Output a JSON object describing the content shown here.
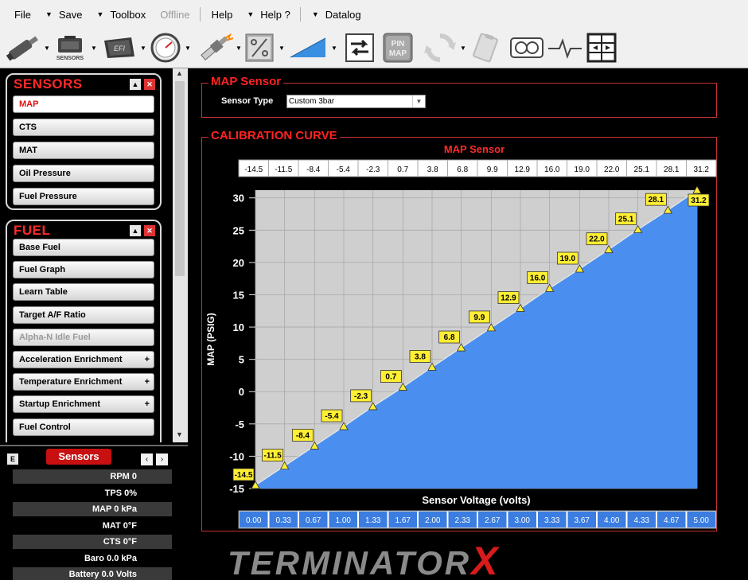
{
  "menu": {
    "items": [
      {
        "label": "File",
        "arrow": false
      },
      {
        "label": "Save",
        "arrow": true
      },
      {
        "label": "Toolbox",
        "arrow": true
      },
      {
        "label": "Offline",
        "arrow": false,
        "disabled": true
      },
      {
        "label": "Help",
        "arrow": false
      },
      {
        "label": "Help ?",
        "arrow": true
      },
      {
        "label": "Datalog",
        "arrow": true
      }
    ]
  },
  "toolbar": {
    "sensors_label": "SENSORS",
    "efi_label": "EFI",
    "pinmap_label_top": "PIN",
    "pinmap_label_bottom": "MAP",
    "icons": [
      "injector-icon",
      "sensors-module-icon",
      "efi-ecu-icon",
      "gauge-icon",
      "spark-plug-icon",
      "percent-icon",
      "ramp-icon",
      "transfer-icon",
      "pin-map-icon",
      "refresh-icon",
      "clipboard-icon",
      "dash-gauges-icon",
      "heartbeat-icon",
      "grid-window-icon"
    ]
  },
  "sensors_section": {
    "title": "SENSORS",
    "items": [
      {
        "label": "MAP",
        "active": true
      },
      {
        "label": "CTS"
      },
      {
        "label": "MAT"
      },
      {
        "label": "Oil Pressure"
      },
      {
        "label": "Fuel Pressure"
      }
    ]
  },
  "fuel_section": {
    "title": "FUEL",
    "items": [
      {
        "label": "Base Fuel",
        "suffix": ""
      },
      {
        "label": "Fuel Graph",
        "suffix": ""
      },
      {
        "label": "Learn Table",
        "suffix": ""
      },
      {
        "label": "Target A/F Ratio",
        "suffix": ""
      },
      {
        "label": "Alpha-N Idle Fuel",
        "suffix": "",
        "disabled": true
      },
      {
        "label": "Acceleration Enrichment",
        "suffix": "+"
      },
      {
        "label": "Temperature Enrichment",
        "suffix": "+"
      },
      {
        "label": "Startup Enrichment",
        "suffix": "+"
      },
      {
        "label": "Fuel Control",
        "suffix": ""
      }
    ]
  },
  "sensor_panel": {
    "e_label": "E",
    "title": "Sensors",
    "rows": [
      "RPM 0",
      "TPS 0%",
      "MAP 0 kPa",
      "MAT 0°F",
      "CTS 0°F",
      "Baro 0.0 kPa",
      "Battery 0.0 Volts"
    ]
  },
  "map_sensor": {
    "frame_title": "MAP Sensor",
    "sensor_type_label": "Sensor Type",
    "sensor_type_value": "Custom 3bar"
  },
  "calibration": {
    "frame_title": "CALIBRATION CURVE",
    "chart_title": "MAP Sensor"
  },
  "chart_data": {
    "type": "area",
    "title": "MAP Sensor",
    "xlabel": "Sensor Voltage (volts)",
    "ylabel": "MAP (PSIG)",
    "x": [
      0.0,
      0.33,
      0.67,
      1.0,
      1.33,
      1.67,
      2.0,
      2.33,
      2.67,
      3.0,
      3.33,
      3.67,
      4.0,
      4.33,
      4.67,
      5.0
    ],
    "x_labels": [
      "0.00",
      "0.33",
      "0.67",
      "1.00",
      "1.33",
      "1.67",
      "2.00",
      "2.33",
      "2.67",
      "3.00",
      "3.33",
      "3.67",
      "4.00",
      "4.33",
      "4.67",
      "5.00"
    ],
    "y": [
      -14.5,
      -11.5,
      -8.4,
      -5.4,
      -2.3,
      0.7,
      3.8,
      6.8,
      9.9,
      12.9,
      16.0,
      19.0,
      22.0,
      25.1,
      28.1,
      31.2
    ],
    "y_labels": [
      "-14.5",
      "-11.5",
      "-8.4",
      "-5.4",
      "-2.3",
      "0.7",
      "3.8",
      "6.8",
      "9.9",
      "12.9",
      "16.0",
      "19.0",
      "22.0",
      "25.1",
      "28.1",
      "31.2"
    ],
    "y_ticks": [
      "30",
      "25",
      "20",
      "15",
      "10",
      "5",
      "0",
      "-5",
      "-10",
      "-15"
    ],
    "ylim": [
      -15,
      31.2
    ],
    "grid": true,
    "colors": {
      "fill": "#4a8ff0",
      "plot_bg": "#cfcfcf",
      "label_bg": "#ffee33",
      "x_row": "#3b7de0"
    }
  },
  "logo": {
    "text": "TERMINATOR",
    "x_mark": "X"
  }
}
